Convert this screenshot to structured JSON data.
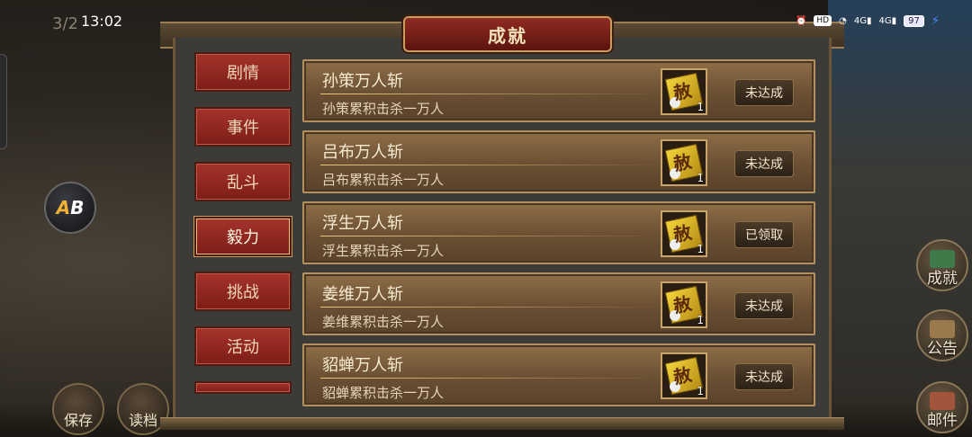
{
  "status_bar": {
    "time": "13:02",
    "hd_label": "HD",
    "signal_a": "4G",
    "signal_b": "4G",
    "battery": "97"
  },
  "pager": "3/2",
  "badge": {
    "left": "A",
    "right": "B"
  },
  "panel": {
    "title": "成就"
  },
  "tabs": [
    {
      "label": "剧情",
      "active": false
    },
    {
      "label": "事件",
      "active": false
    },
    {
      "label": "乱斗",
      "active": false
    },
    {
      "label": "毅力",
      "active": true
    },
    {
      "label": "挑战",
      "active": false
    },
    {
      "label": "活动",
      "active": false
    }
  ],
  "achievements": [
    {
      "name": "孙策万人斩",
      "desc": "孙策累积击杀一万人",
      "reward_count": "1",
      "status": "未达成"
    },
    {
      "name": "吕布万人斩",
      "desc": "吕布累积击杀一万人",
      "reward_count": "1",
      "status": "未达成"
    },
    {
      "name": "浮生万人斩",
      "desc": "浮生累积击杀一万人",
      "reward_count": "1",
      "status": "已领取"
    },
    {
      "name": "姜维万人斩",
      "desc": "姜维累积击杀一万人",
      "reward_count": "1",
      "status": "未达成"
    },
    {
      "name": "貂蝉万人斩",
      "desc": "貂蝉累积击杀一万人",
      "reward_count": "1",
      "status": "未达成"
    }
  ],
  "right_buttons": {
    "achievement": "成就",
    "notice": "公告",
    "mail": "邮件"
  },
  "left_buttons": {
    "save": "保存",
    "load": "读档"
  }
}
